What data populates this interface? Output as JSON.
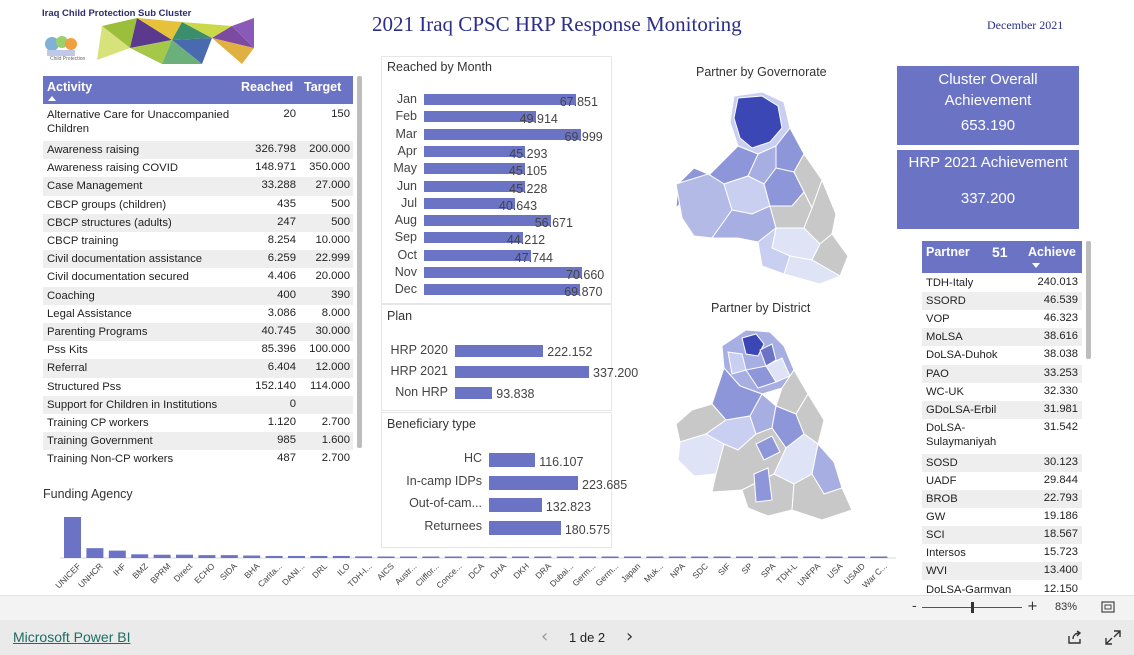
{
  "header": {
    "title": "2021 Iraq CPSC HRP Response Monitoring",
    "date": "December 2021",
    "logo_text": "Iraq Child Protection Sub Cluster",
    "logo_subtext": "Child Protection"
  },
  "activity_table": {
    "columns": [
      "Activity",
      "Reached",
      "Target"
    ],
    "rows": [
      [
        "Alternative Care for Unaccompanied Children",
        "20",
        "150"
      ],
      [
        "Awareness raising",
        "326.798",
        "200.000"
      ],
      [
        "Awareness raising COVID",
        "148.971",
        "350.000"
      ],
      [
        "Case Management",
        "33.288",
        "27.000"
      ],
      [
        "CBCP groups (children)",
        "435",
        "500"
      ],
      [
        "CBCP structures (adults)",
        "247",
        "500"
      ],
      [
        "CBCP training",
        "8.254",
        "10.000"
      ],
      [
        "Civil documentation assistance",
        "6.259",
        "22.999"
      ],
      [
        "Civil documentation secured",
        "4.406",
        "20.000"
      ],
      [
        "Coaching",
        "400",
        "390"
      ],
      [
        "Legal Assistance",
        "3.086",
        "8.000"
      ],
      [
        "Parenting Programs",
        "40.745",
        "30.000"
      ],
      [
        "Pss Kits",
        "85.396",
        "100.000"
      ],
      [
        "Referral",
        "6.404",
        "12.000"
      ],
      [
        "Structured Pss",
        "152.140",
        "114.000"
      ],
      [
        "Support for Children in Institutions",
        "0",
        ""
      ],
      [
        "Training CP workers",
        "1.120",
        "2.700"
      ],
      [
        "Training Government",
        "985",
        "1.600"
      ],
      [
        "Training Non-CP workers",
        "487",
        "2.700"
      ]
    ]
  },
  "reached_by_month": {
    "title": "Reached by Month",
    "type": "bar",
    "categories": [
      "Jan",
      "Feb",
      "Mar",
      "Apr",
      "May",
      "Jun",
      "Jul",
      "Aug",
      "Sep",
      "Oct",
      "Nov",
      "Dec"
    ],
    "values": [
      67851,
      49914,
      69999,
      45293,
      45105,
      45228,
      40643,
      56671,
      44212,
      47744,
      70660,
      69870
    ],
    "labels": [
      "67.851",
      "49.914",
      "69.999",
      "45.293",
      "45.105",
      "45.228",
      "40.643",
      "56.671",
      "44.212",
      "47.744",
      "70.660",
      "69.870"
    ]
  },
  "plan": {
    "title": "Plan",
    "categories": [
      "HRP 2020",
      "HRP 2021",
      "Non HRP"
    ],
    "values": [
      222152,
      337200,
      93838
    ],
    "labels": [
      "222.152",
      "337.200",
      "93.838"
    ]
  },
  "beneficiary": {
    "title": "Beneficiary type",
    "categories": [
      "HC",
      "In-camp IDPs",
      "Out-of-cam...",
      "Returnees"
    ],
    "values": [
      116107,
      223685,
      132823,
      180575
    ],
    "labels": [
      "116.107",
      "223.685",
      "132.823",
      "180.575"
    ]
  },
  "maps": {
    "governorate_title": "Partner by Governorate",
    "district_title": "Partner by District"
  },
  "cards": {
    "overall_title": "Cluster Overall Achievement",
    "overall_value": "653.190",
    "hrp_title": "HRP 2021 Achievement",
    "hrp_value": "337.200"
  },
  "partner_table": {
    "col_partner": "Partner",
    "count": "51",
    "col_achieve": "Achieve",
    "rows": [
      [
        "TDH-Italy",
        "240.013"
      ],
      [
        "SSORD",
        "46.539"
      ],
      [
        "VOP",
        "46.323"
      ],
      [
        "MoLSA",
        "38.616"
      ],
      [
        "DoLSA-Duhok",
        "38.038"
      ],
      [
        "PAO",
        "33.253"
      ],
      [
        "WC-UK",
        "32.330"
      ],
      [
        "GDoLSA-Erbil",
        "31.981"
      ],
      [
        "DoLSA-Sulaymaniyah",
        "31.542"
      ],
      [
        "SOSD",
        "30.123"
      ],
      [
        "UADF",
        "29.844"
      ],
      [
        "BROB",
        "22.793"
      ],
      [
        "GW",
        "19.186"
      ],
      [
        "SCI",
        "18.567"
      ],
      [
        "Intersos",
        "15.723"
      ],
      [
        "WVI",
        "13.400"
      ],
      [
        "DoLSA-Garmyan",
        "12.150"
      ]
    ]
  },
  "funding": {
    "title": "Funding Agency",
    "type": "bar",
    "categories": [
      "UNICEF",
      "UNHCR",
      "IHF",
      "BMZ",
      "BPRM",
      "Direct",
      "ECHO",
      "SIDA",
      "BHA",
      "Carita...",
      "DANI...",
      "DRL",
      "ILO",
      "TDH-I...",
      "AICS",
      "Austr...",
      "Cliffor...",
      "Conce...",
      "DCA",
      "DHA",
      "DKH",
      "DRA",
      "Dubai...",
      "Germ...",
      "Germ...",
      "Japan",
      "Muk...",
      "NPA",
      "SDC",
      "SIF",
      "SP",
      "SPA",
      "TDH-L",
      "UNFPA",
      "USA",
      "USAID",
      "War C..."
    ],
    "values": [
      100,
      24,
      18,
      9,
      8,
      8,
      7,
      7,
      6,
      5,
      5,
      5,
      5,
      4,
      3,
      2,
      2,
      2,
      2,
      2,
      2,
      2,
      2,
      2,
      2,
      2,
      2,
      2,
      2,
      2,
      2,
      2,
      2,
      2,
      2,
      2,
      2
    ]
  },
  "zoom": {
    "minus": "-",
    "plus": "+",
    "level": "83%",
    "slider_fraction": 0.5
  },
  "footer": {
    "brand": "Microsoft Power BI",
    "page": "1 de 2",
    "prev": "‹",
    "next": "›"
  },
  "colors": {
    "accent": "#6b73c4",
    "title": "#2b2f8a",
    "map_dark": "#3b47b5",
    "map_mid": "#8d96d8",
    "map_light": "#c9cff0",
    "map_gray": "#c8c8c8"
  }
}
